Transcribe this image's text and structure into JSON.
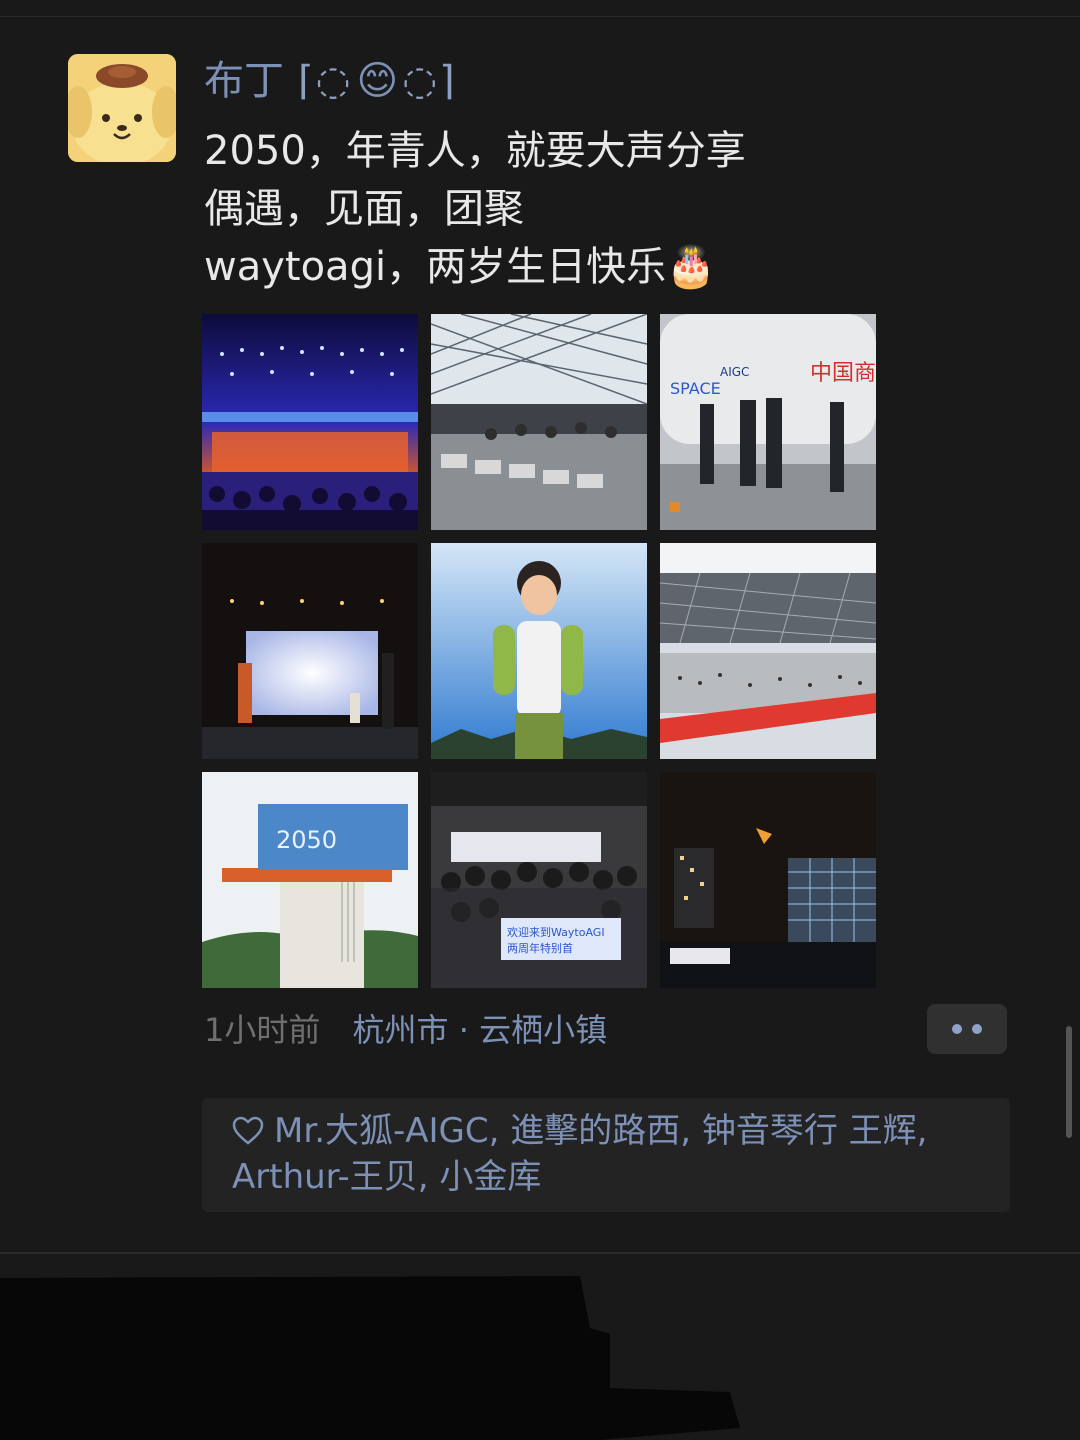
{
  "post": {
    "username": "布丁",
    "username_deco": {
      "left": "⌈◌",
      "emoji": "😊",
      "right": "◌⌉"
    },
    "lines": [
      "2050，年青人，就要大声分享",
      "偶遇，见面，团聚",
      "waytoagi，两岁生日快乐🎂"
    ],
    "photos": [
      "concert-stage-photo",
      "robot-dogs-photo",
      "graffiti-tank-photo",
      "dance-performance-photo",
      "child-portrait-photo",
      "building-plaza-photo",
      "2050-tower-photo",
      "group-photo",
      "night-city-photo"
    ],
    "group_banner_text": "欢迎来到WaytoAGI\n两周年特别首",
    "tower_text": "2050",
    "time": "1小时前",
    "location": "杭州市 · 云栖小镇",
    "more_icon": "more-dots-icon"
  },
  "likes": {
    "icon": "heart-outline-icon",
    "names_line1": "Mr.大狐-AIGC, 進擊的路西, 钟音琴行 王辉,",
    "names_line2": "Arthur-王贝, 小金库"
  },
  "colors": {
    "background": "#191919",
    "name_link": "#7d90b5",
    "body_text": "#e8e8e8",
    "meta_gray": "#6f6f6f",
    "likes_bg": "#232323"
  }
}
